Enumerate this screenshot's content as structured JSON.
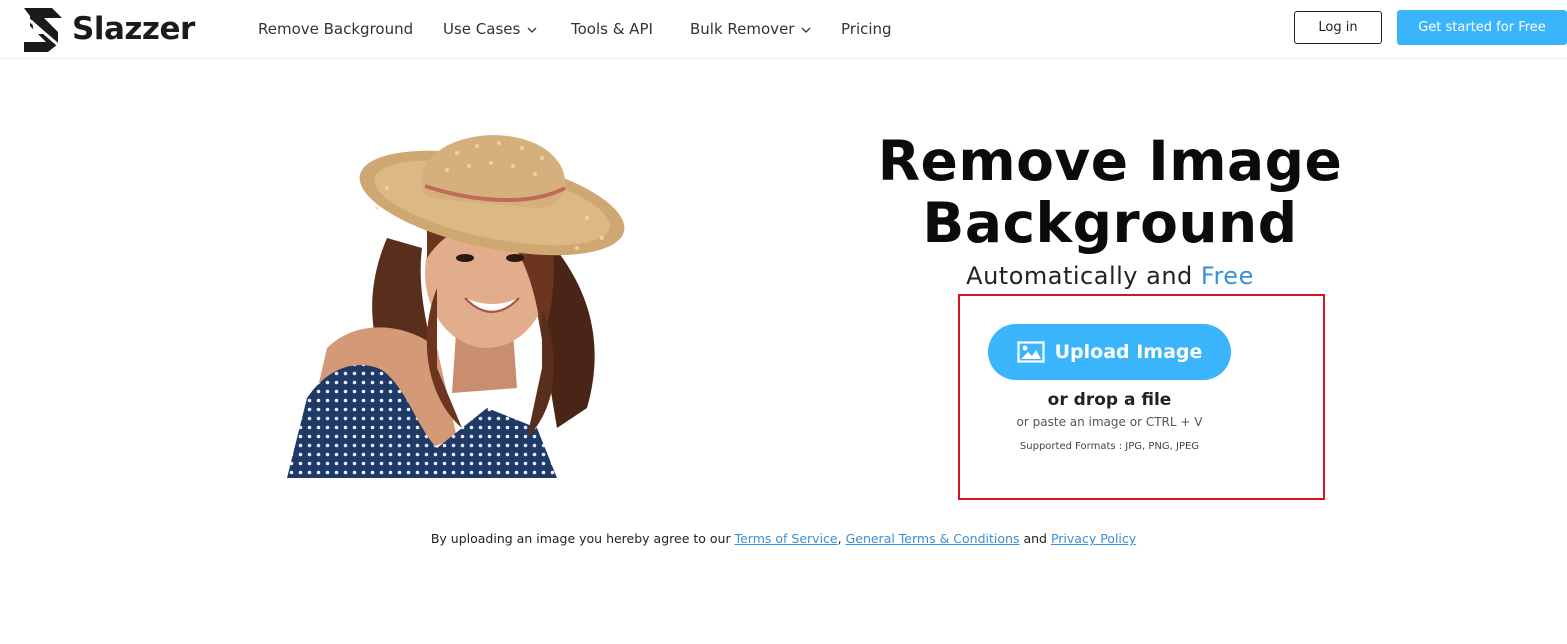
{
  "brand": {
    "name": "Slazzer",
    "logo_icon": "slazzer-logo-icon",
    "accent": "#3ab4fa",
    "link_color": "#3a8fd8",
    "highlight_border": "#d9131e"
  },
  "nav": {
    "items": [
      {
        "label": "Remove Background",
        "has_dropdown": false
      },
      {
        "label": "Use Cases",
        "has_dropdown": true
      },
      {
        "label": "Tools & API",
        "has_dropdown": false
      },
      {
        "label": "Bulk Remover",
        "has_dropdown": true
      },
      {
        "label": "Pricing",
        "has_dropdown": false
      }
    ],
    "login_label": "Log in",
    "cta_label": "Get started for Free"
  },
  "hero": {
    "image_icon": "woman-in-sun-hat-photo",
    "title_line1": "Remove Image",
    "title_line2": "Background",
    "subtitle_prefix": "Automatically and",
    "subtitle_highlight": "Free"
  },
  "upload": {
    "button_label": "Upload Image",
    "button_icon": "image-icon",
    "drop_text": "or drop a file",
    "paste_text": "or paste an image or CTRL + V",
    "formats_text": "Supported Formats : JPG, PNG, JPEG"
  },
  "legal": {
    "prefix": "By uploading an image you hereby agree to our",
    "terms_label": "Terms of Service",
    "separator": ",",
    "general_label": "General Terms & Conditions",
    "and_text": "and",
    "privacy_label": "Privacy Policy"
  }
}
